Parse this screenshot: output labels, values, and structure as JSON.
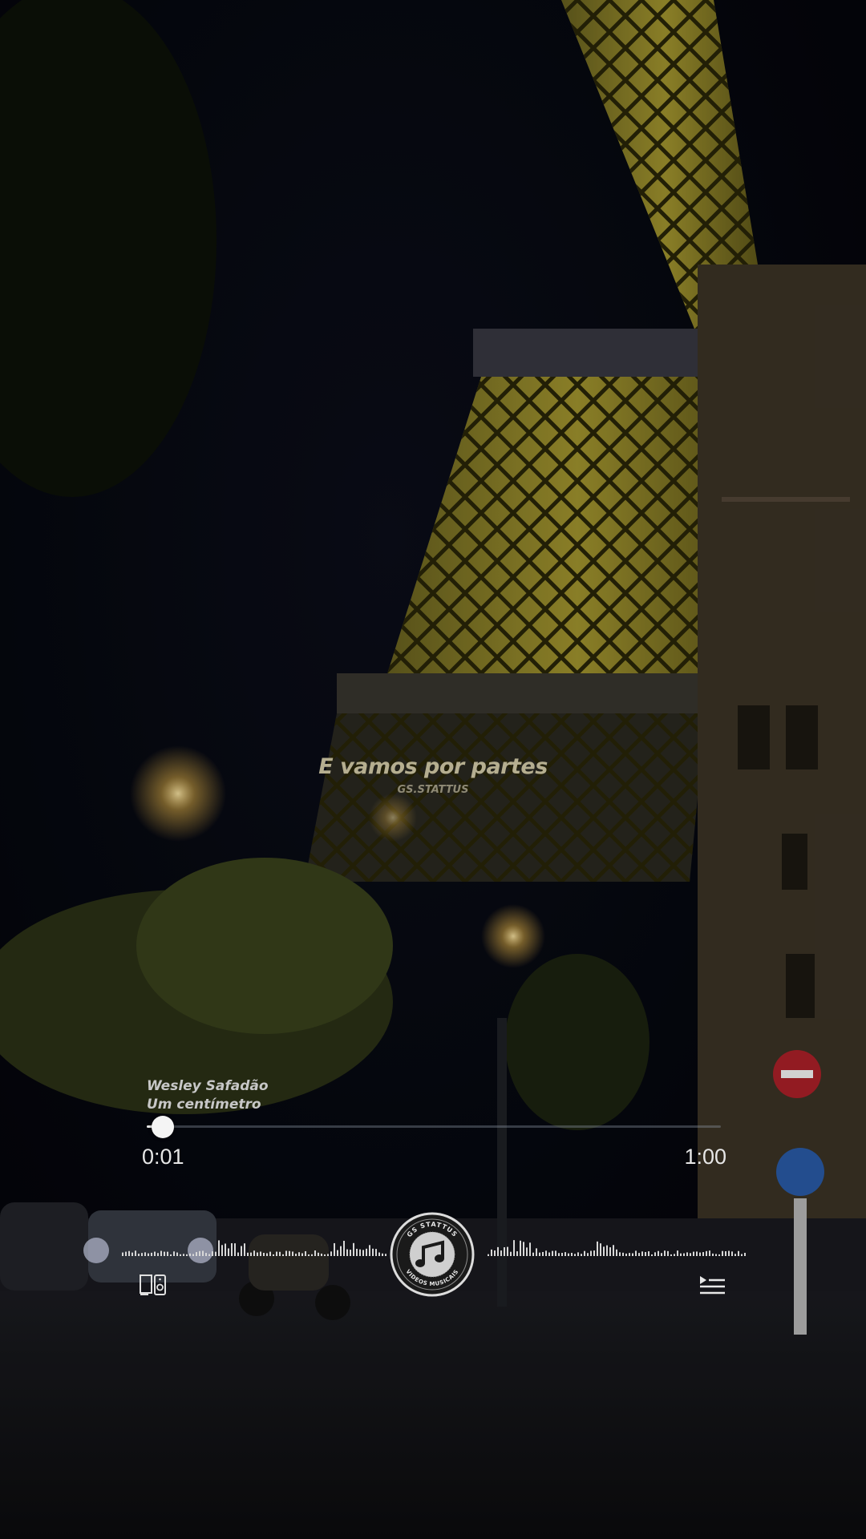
{
  "lyric": {
    "line": "E vamos por partes",
    "credit": "GS.STATTUS"
  },
  "track": {
    "artist": "Wesley Safadão",
    "title": "Um centímetro"
  },
  "player": {
    "current_time": "0:01",
    "total_time": "1:00",
    "progress_fraction": 0.017
  },
  "logo": {
    "top_text": "GS STATTUS",
    "bottom_text": "VIDEOS MUSICAIS"
  },
  "icons": {
    "device": "device-speaker-icon",
    "queue": "queue-list-icon",
    "logo": "music-note-icon"
  },
  "colors": {
    "lyric": "#b5ae90",
    "track_text": "#c7c7c7",
    "accent": "#f4f4f4"
  }
}
